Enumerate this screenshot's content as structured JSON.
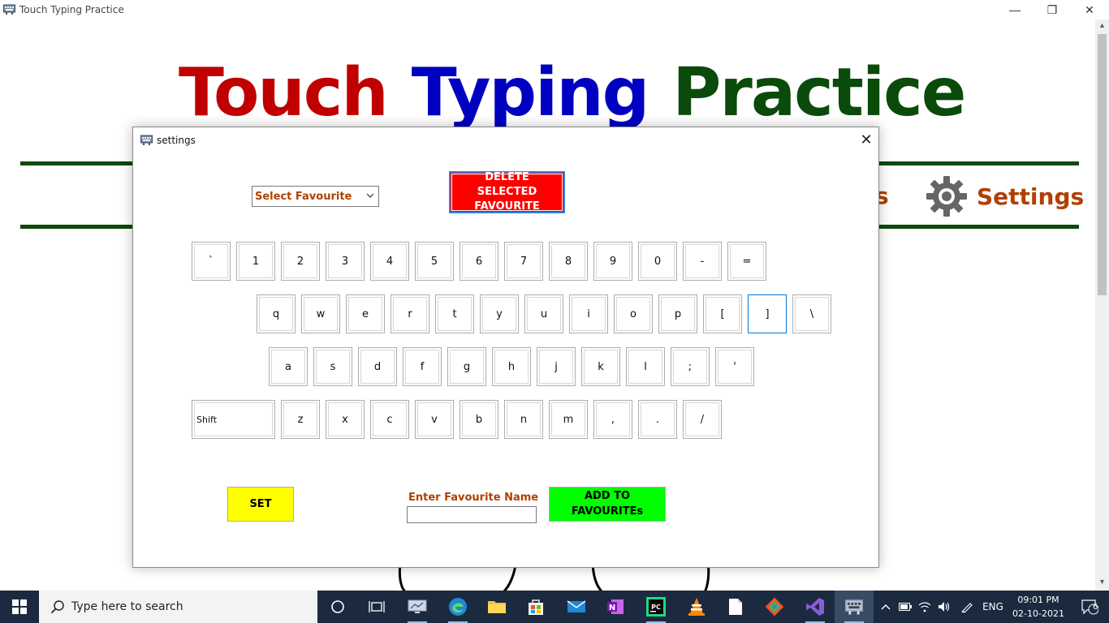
{
  "window": {
    "title": "Touch Typing Practice",
    "minimize_symbol": "—",
    "restore_symbol": "❐",
    "close_symbol": "✕"
  },
  "main": {
    "title_words": [
      "Touch",
      "Typing",
      "Practice"
    ],
    "title_colors": [
      "#c00000",
      "#0000c0",
      "#0a4a0a"
    ],
    "nav_partial_text": "s",
    "nav_settings_label": "Settings",
    "accent_color": "#b04000",
    "rule_color": "#0a4a0a"
  },
  "dialog": {
    "title": "settings",
    "close_symbol": "✕",
    "favourite_select": {
      "selected": "Select Favourite"
    },
    "delete_button": "DELETE SELECTED FAVOURITE",
    "keyboard_rows": [
      [
        "`",
        "1",
        "2",
        "3",
        "4",
        "5",
        "6",
        "7",
        "8",
        "9",
        "0",
        "-",
        "="
      ],
      [
        "q",
        "w",
        "e",
        "r",
        "t",
        "y",
        "u",
        "i",
        "o",
        "p",
        "[",
        "]",
        "\\"
      ],
      [
        "a",
        "s",
        "d",
        "f",
        "g",
        "h",
        "j",
        "k",
        "l",
        ";",
        "'"
      ],
      [
        "Shift",
        "z",
        "x",
        "c",
        "v",
        "b",
        "n",
        "m",
        ",",
        ".",
        "/"
      ]
    ],
    "focused_key": "]",
    "set_button": "SET",
    "favourite_name_label": "Enter Favourite Name",
    "favourite_name_value": "",
    "add_button": "ADD TO FAVOURITEs",
    "colors": {
      "delete_bg": "#ff0000",
      "set_bg": "#ffff00",
      "add_bg": "#00ff00"
    }
  },
  "taskbar": {
    "search_placeholder": "Type here to search",
    "icons": [
      "cortana-icon",
      "task-view-icon",
      "monitor-app-icon",
      "edge-icon",
      "file-explorer-icon",
      "store-icon",
      "mail-icon",
      "onenote-icon",
      "pycharm-icon",
      "vlc-icon",
      "notepad-icon",
      "git-icon",
      "visual-studio-icon",
      "typing-app-icon"
    ],
    "tray": {
      "language": "ENG",
      "time": "09:01 PM",
      "date": "02-10-2021",
      "notification_count": "6"
    }
  }
}
